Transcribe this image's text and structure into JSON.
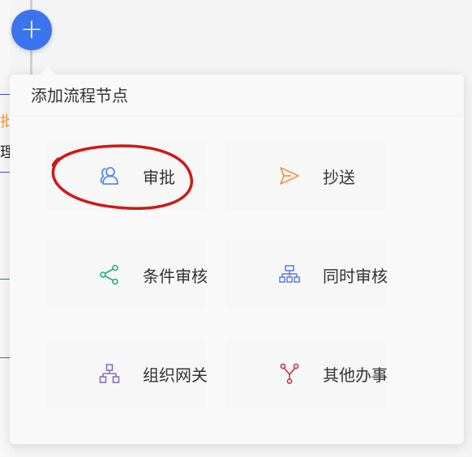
{
  "background_left": {
    "text_orange": "批",
    "text_dark": "理"
  },
  "add_button": {
    "symbol": "+"
  },
  "popup": {
    "title": "添加流程节点",
    "options": [
      {
        "label": "审批",
        "icon": "approver-icon",
        "color": "#3b7ff0"
      },
      {
        "label": "抄送",
        "icon": "send-icon",
        "color": "#f39540"
      },
      {
        "label": "条件审核",
        "icon": "share-branch-icon",
        "color": "#1daf78"
      },
      {
        "label": "同时审核",
        "icon": "org-chart-icon",
        "color": "#5a78e0"
      },
      {
        "label": "组织网关",
        "icon": "hierarchy-icon",
        "color": "#8a6fb8"
      },
      {
        "label": "其他办事",
        "icon": "fork-icon",
        "color": "#c2364a"
      }
    ]
  },
  "annotation": {
    "shape": "red-ellipse-highlight",
    "target": "审批",
    "color": "#d01818"
  }
}
